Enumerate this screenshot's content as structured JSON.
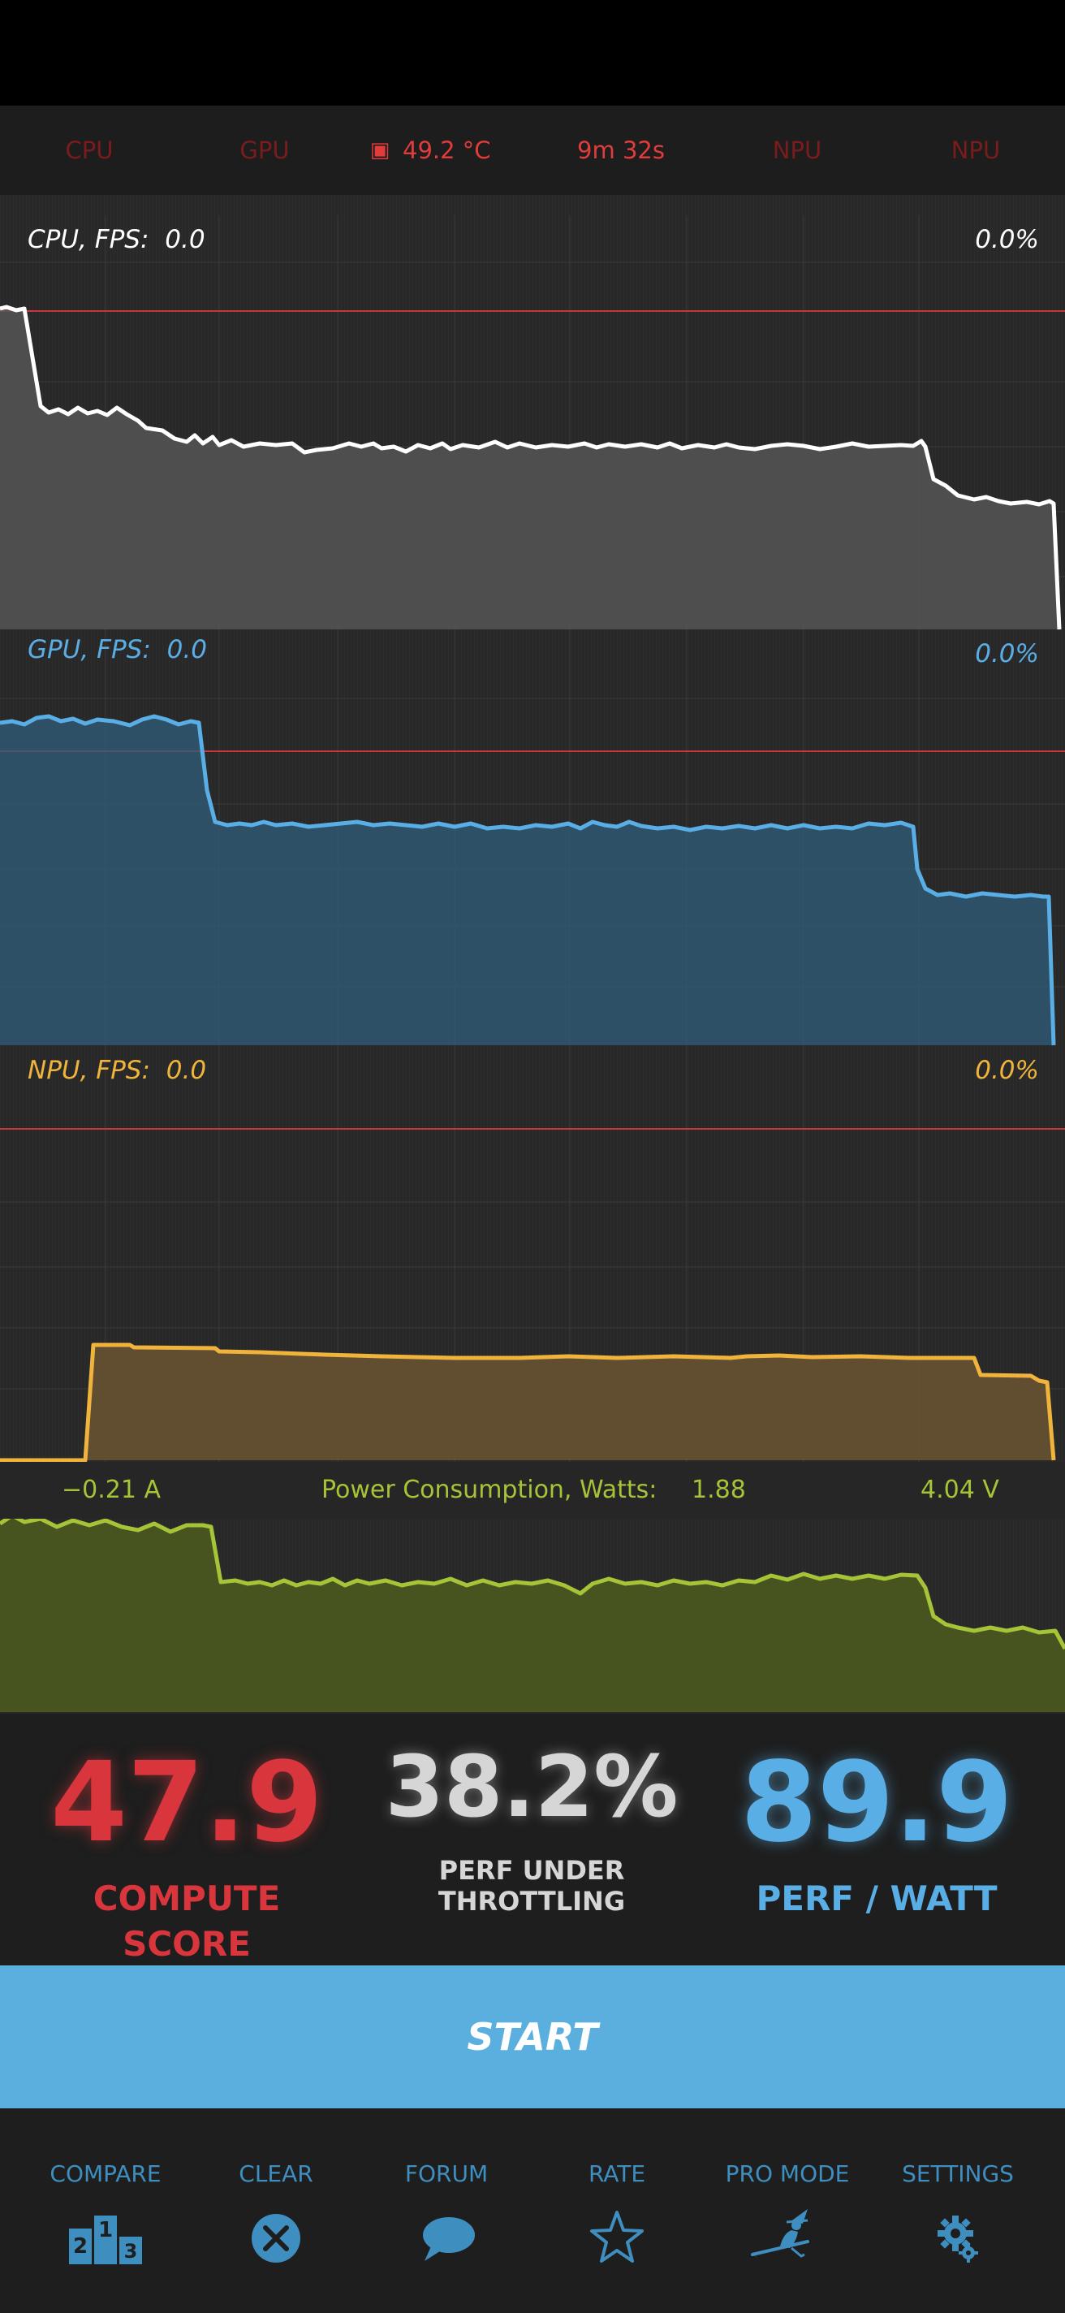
{
  "indicators": {
    "cpu": "CPU",
    "gpu": "GPU",
    "temperature": "49.2 °C",
    "elapsed": "9m 32s",
    "npu1": "NPU",
    "npu2": "NPU"
  },
  "panels": {
    "cpu": {
      "label": "CPU, FPS:",
      "fps": "0.0",
      "percent": "0.0%"
    },
    "gpu": {
      "label": "GPU, FPS:",
      "fps": "0.0",
      "percent": "0.0%"
    },
    "npu": {
      "label": "NPU, FPS:",
      "fps": "0.0",
      "percent": "0.0%"
    }
  },
  "power": {
    "current": "−0.21 A",
    "label": "Power Consumption, Watts:",
    "watts": "1.88",
    "voltage": "4.04 V"
  },
  "stats": {
    "compute_score": "47.9",
    "compute_label": "COMPUTE SCORE",
    "throttle_value": "38.2%",
    "throttle_label_1": "PERF UNDER",
    "throttle_label_2": "THROTTLING",
    "perf_watt": "89.9",
    "perf_watt_label": "PERF / WATT"
  },
  "start_label": "START",
  "nav": [
    {
      "label": "COMPARE",
      "icon": "podium-icon"
    },
    {
      "label": "CLEAR",
      "icon": "clear-x-icon"
    },
    {
      "label": "FORUM",
      "icon": "chat-bubble-icon"
    },
    {
      "label": "RATE",
      "icon": "star-icon"
    },
    {
      "label": "PRO MODE",
      "icon": "witch-icon"
    },
    {
      "label": "SETTINGS",
      "icon": "gear-icon"
    }
  ],
  "colors": {
    "cpu": "#ffffff",
    "gpu": "#5aaee6",
    "npu": "#f0b43c",
    "power": "#a5c437",
    "accent_red": "#d8363c",
    "accent_blue": "#5aafdf",
    "threshold": "#c8363a"
  }
}
